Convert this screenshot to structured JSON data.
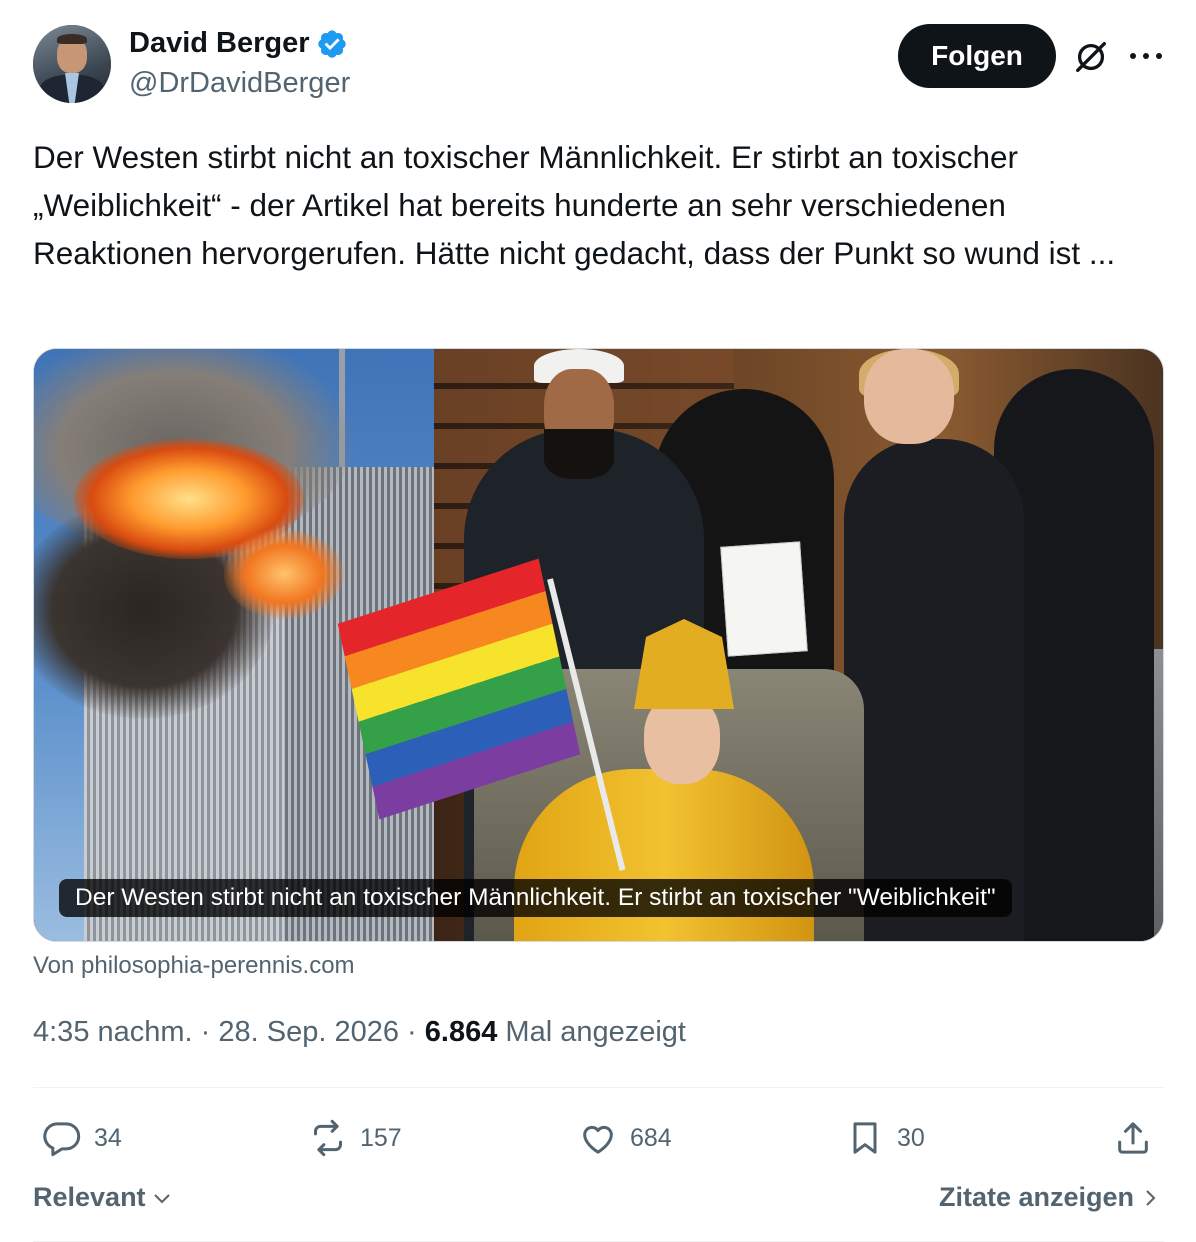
{
  "author": {
    "name": "David Berger",
    "handle": "@DrDavidBerger"
  },
  "header": {
    "follow_label": "Folgen",
    "icons": [
      "grok-icon",
      "more-icon"
    ]
  },
  "tweet": {
    "text": "Der Westen stirbt nicht an toxischer Männlichkeit. Er stirbt an toxischer „Weiblichkeit“ - der Artikel hat bereits hunderte an sehr verschiedenen Reaktionen hervorgerufen. Hätte nicht gedacht, dass der Punkt so wund ist ...",
    "card_caption": "Der Westen stirbt nicht an toxischer Männlichkeit. Er stirbt an toxischer \"Weiblichkeit\"",
    "card_source": "Von philosophia-perennis.com",
    "time": "4:35 nachm.",
    "sep1": " · ",
    "date": "28. Sep. 2026",
    "sep2": " · ",
    "views_count": "6.864",
    "views_label": " Mal angezeigt"
  },
  "actions": {
    "replies": "34",
    "reposts": "157",
    "likes": "684",
    "bookmarks": "30"
  },
  "footer": {
    "sort_label": "Relevant",
    "quotes_label": "Zitate anzeigen"
  },
  "colors": {
    "text": "#0f1419",
    "secondary": "#536471",
    "verified": "#1d9bf0",
    "divider": "#eff3f4"
  }
}
